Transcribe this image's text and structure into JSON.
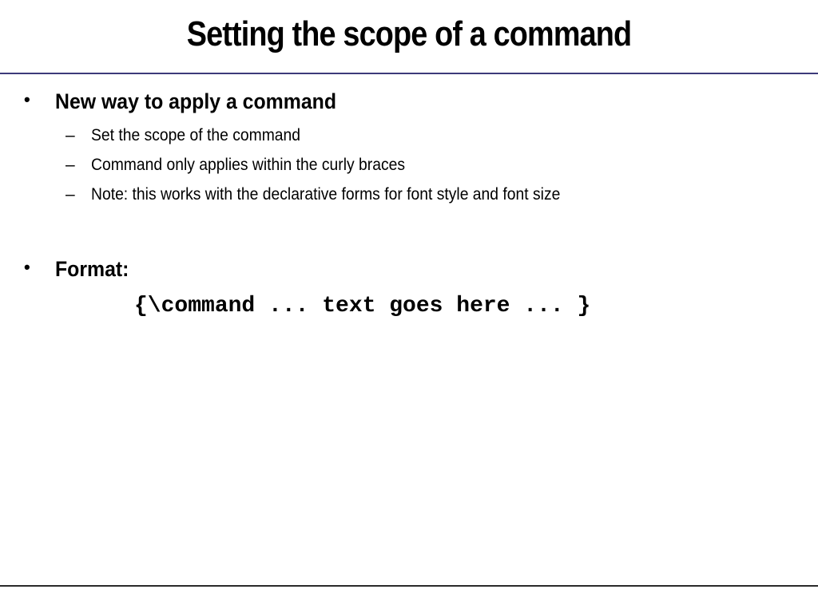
{
  "slide": {
    "title": "Setting the scope of a command",
    "bullets": [
      {
        "text": "New way to apply a command",
        "subitems": [
          "Set the scope of the command",
          "Command only applies within the curly braces",
          "Note:  this works with the declarative forms for font style and font size"
        ]
      },
      {
        "text": "Format:",
        "code": "{\\command ... text goes here ... }"
      }
    ],
    "bullet_glyph": "•",
    "sub_bullet_glyph": "–",
    "colors": {
      "title_rule": "#3d3a7a",
      "footer_rule": "#2a2a2a",
      "text": "#000000"
    }
  }
}
